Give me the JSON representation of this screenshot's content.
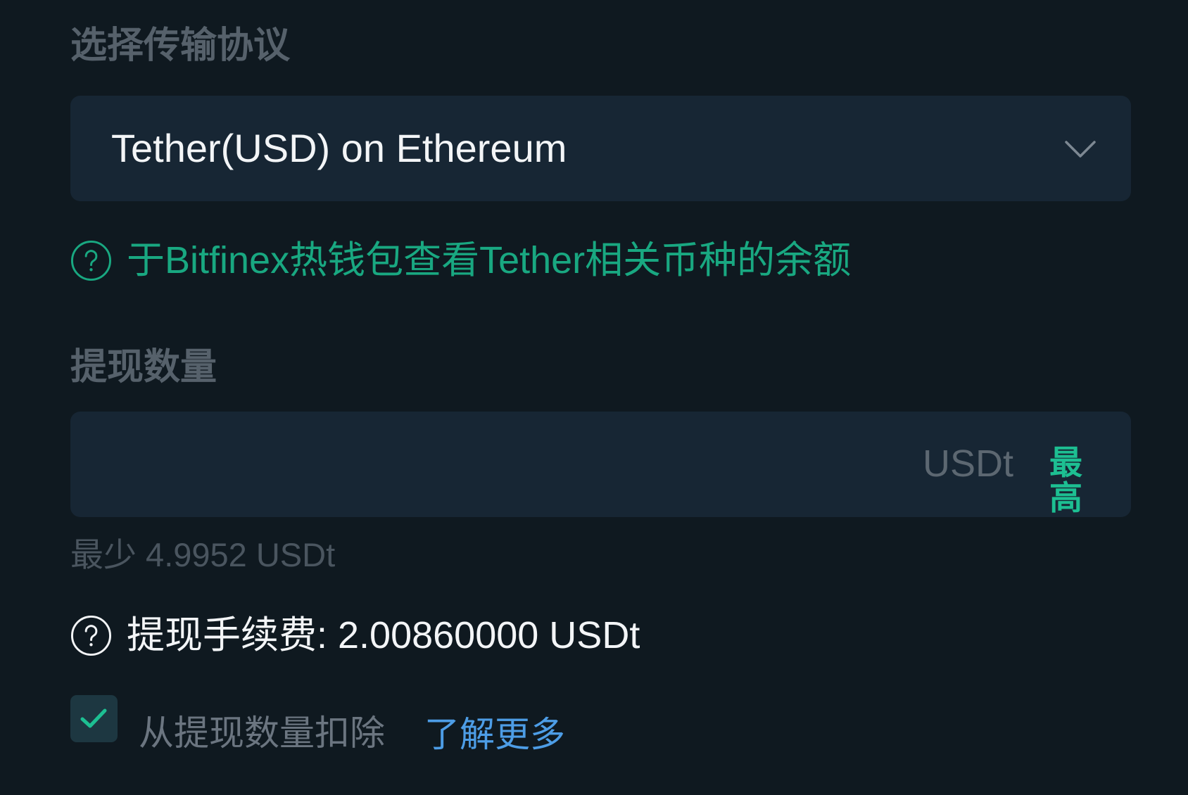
{
  "protocol_section": {
    "label": "选择传输协议",
    "selected": "Tether(USD) on Ethereum",
    "dropdown_icon": "chevron-down-icon"
  },
  "balance_help": {
    "icon": "question-circle-icon",
    "text": "于Bitfinex热钱包查看Tether相关币种的余额"
  },
  "amount_section": {
    "label": "提现数量",
    "value": "",
    "unit": "USDt",
    "max_label": "最高",
    "minimum_text": "最少 4.9952 USDt"
  },
  "fee": {
    "icon": "question-circle-icon",
    "text": "提现手续费: 2.00860000 USDt"
  },
  "deduct": {
    "checked": true,
    "check_icon": "checkmark-icon",
    "label": "从提现数量扣除",
    "learn_more": "了解更多"
  },
  "colors": {
    "background": "#0f1920",
    "field_background": "#172634",
    "label_gray": "#56616b",
    "accent_green": "#19a881",
    "max_green": "#1dbf92",
    "link_blue": "#4d9de6",
    "text_white": "#f3f5f7",
    "checkbox_background": "#1d3741"
  }
}
